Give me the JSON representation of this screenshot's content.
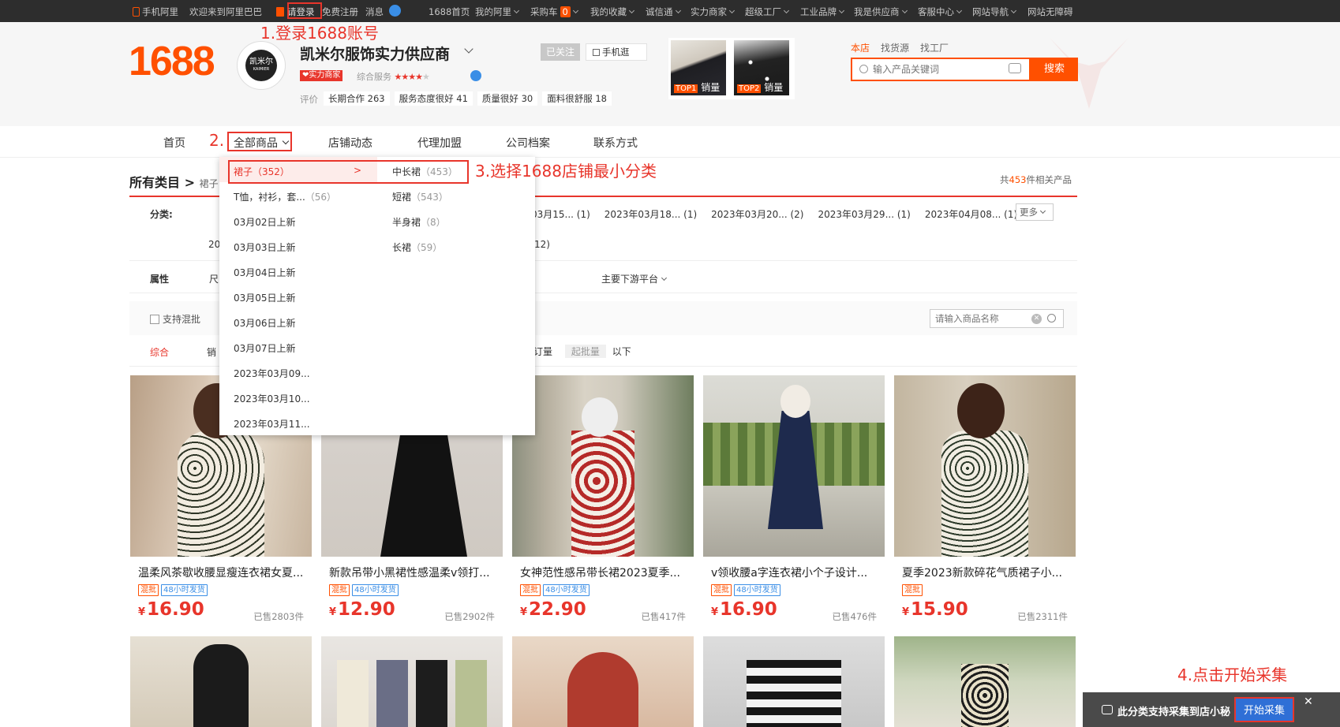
{
  "topbar": {
    "mobile_ali": "手机阿里",
    "welcome": "欢迎来到阿里巴巴",
    "login": "请登录",
    "register": "免费注册",
    "messages": "消息",
    "nav": [
      "1688首页",
      "我的阿里",
      "采购车",
      "我的收藏",
      "诚信通",
      "实力商家",
      "超级工厂",
      "工业品牌",
      "我是供应商",
      "客服中心",
      "网站导航",
      "网站无障碍"
    ],
    "cart_count": "0"
  },
  "header": {
    "logo": "1688",
    "store_logo_text": "凯米尔",
    "store_logo_sub": "KAIMIER",
    "shop_name": "凯米尔服饰实力供应商",
    "badge": "实力商家",
    "service_label": "综合服务",
    "followed": "已关注",
    "mobile_shop": "手机逛",
    "review_label": "评价",
    "reviews": [
      {
        "label": "长期合作",
        "count": "263"
      },
      {
        "label": "服务态度很好",
        "count": "41"
      },
      {
        "label": "质量很好",
        "count": "30"
      },
      {
        "label": "面料很舒服",
        "count": "18"
      }
    ],
    "top_items": [
      {
        "rank": "TOP1",
        "label": "销量"
      },
      {
        "rank": "TOP2",
        "label": "销量"
      }
    ],
    "search_tabs": [
      "本店",
      "找货源",
      "找工厂"
    ],
    "search_placeholder": "输入产品关键词",
    "search_button": "搜索"
  },
  "nav": {
    "items": [
      "首页",
      "全部商品",
      "店铺动态",
      "代理加盟",
      "公司档案",
      "联系方式"
    ]
  },
  "annotations": {
    "step1": "1.登录1688账号",
    "step2": "2.",
    "step3": "3.选择1688店铺最小分类",
    "step4": "4.点击开始采集"
  },
  "breadcrumb": {
    "root": "所有类目",
    "sep": ">",
    "current": "裙子"
  },
  "result_count": {
    "prefix": "共",
    "count": "453",
    "suffix": "件相关产品"
  },
  "filters": {
    "category_label": "分类:",
    "category_visible": [
      "03月15... (1)",
      "2023年03月18... (1)",
      "2023年03月20... (2)",
      "2023年03月29... (1)",
      "2023年04月08... (1)"
    ],
    "row2_fragment": "12)",
    "row2_start": "20",
    "more": "更多",
    "attr_label": "属性",
    "attr_start": "尺",
    "attr_platform": "主要下游平台",
    "mixed": "支持混批",
    "name_search_placeholder": "请输入商品名称",
    "sort_default": "综合",
    "sort_sales_start": "销",
    "order_label": "订量",
    "min_batch": "起批量",
    "below": "以下"
  },
  "dropdown": {
    "left": [
      {
        "label": "裙子",
        "count": "（352）",
        "arrow": ">"
      },
      {
        "label": "T恤，衬衫，套...",
        "count": "（56）"
      },
      {
        "label": "03月02日上新",
        "count": ""
      },
      {
        "label": "03月03日上新",
        "count": ""
      },
      {
        "label": "03月04日上新",
        "count": ""
      },
      {
        "label": "03月05日上新",
        "count": ""
      },
      {
        "label": "03月06日上新",
        "count": ""
      },
      {
        "label": "03月07日上新",
        "count": ""
      },
      {
        "label": "2023年03月09...",
        "count": ""
      },
      {
        "label": "2023年03月10...",
        "count": ""
      },
      {
        "label": "2023年03月11...",
        "count": ""
      }
    ],
    "right": [
      {
        "label": "中长裙",
        "count": "（453）"
      },
      {
        "label": "短裙",
        "count": "（543）"
      },
      {
        "label": "半身裙",
        "count": "（8）"
      },
      {
        "label": "长裙",
        "count": "（59）"
      }
    ]
  },
  "products": [
    {
      "title": "温柔风茶歇收腰显瘦连衣裙女夏...",
      "tags": [
        "混批",
        "48小时发货"
      ],
      "currency": "¥",
      "price": "16.90",
      "sold": "已售2803件"
    },
    {
      "title": "新款吊带小黑裙性感温柔v领打...",
      "tags": [
        "混批",
        "48小时发货"
      ],
      "currency": "¥",
      "price": "12.90",
      "sold": "已售2902件"
    },
    {
      "title": "女神范性感吊带长裙2023夏季...",
      "tags": [
        "混批",
        "48小时发货"
      ],
      "currency": "¥",
      "price": "22.90",
      "sold": "已售417件"
    },
    {
      "title": "v领收腰a字连衣裙小个子设计...",
      "tags": [
        "混批",
        "48小时发货"
      ],
      "currency": "¥",
      "price": "16.90",
      "sold": "已售476件"
    },
    {
      "title": "夏季2023新款碎花气质裙子小...",
      "tags": [
        "混批"
      ],
      "currency": "¥",
      "price": "15.90",
      "sold": "已售2311件"
    }
  ],
  "collect_bar": {
    "text": "此分类支持采集到店小秘",
    "button": "开始采集",
    "close": "✕"
  },
  "colors": {
    "brand": "#ff5000",
    "annotation": "#e8352b",
    "topbar": "#2d2d2d",
    "collect_button": "#2f6fd6"
  }
}
